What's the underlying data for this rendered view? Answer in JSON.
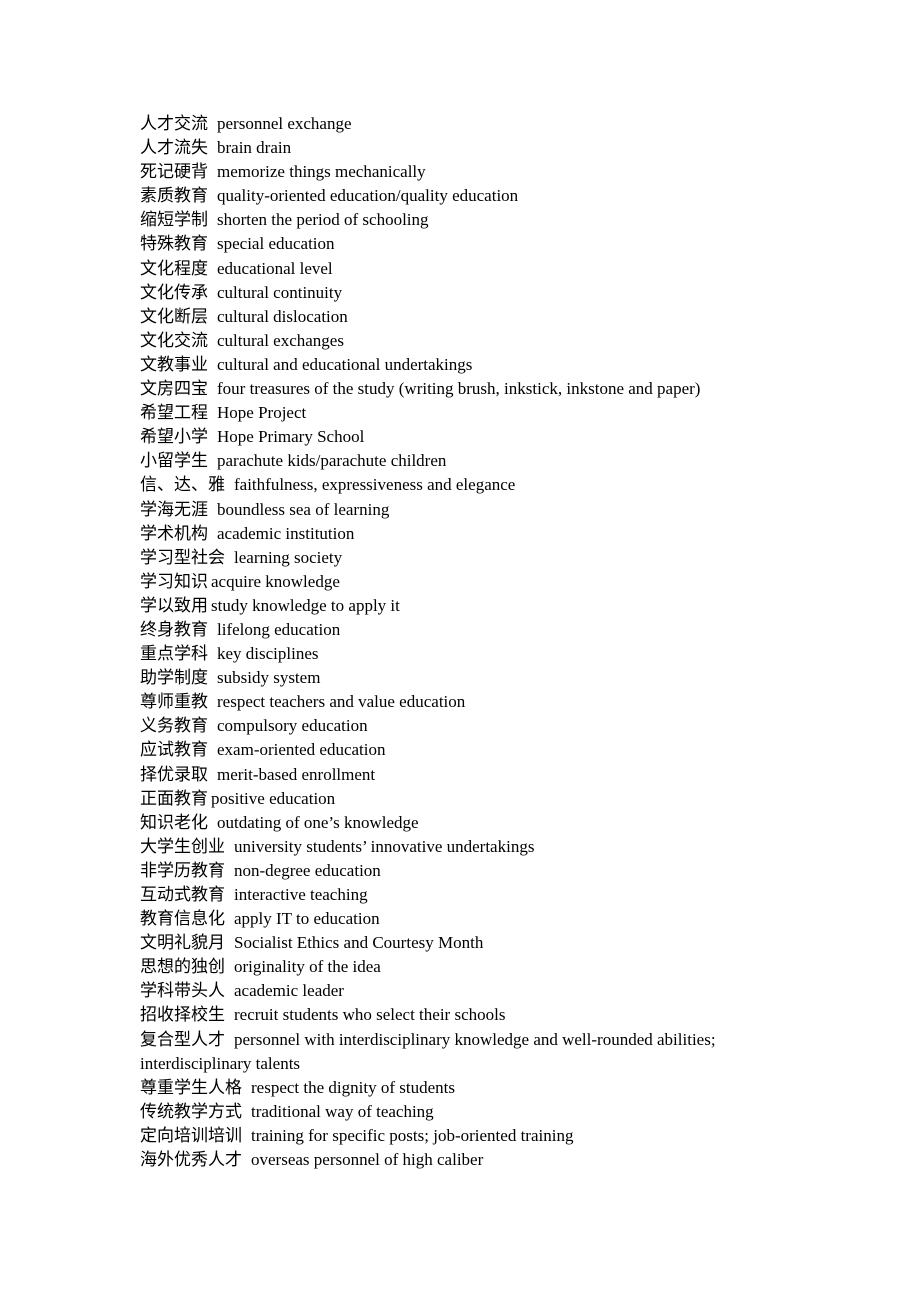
{
  "document": {
    "entries": [
      {
        "zh": "人才交流",
        "en": "personnel exchange",
        "tight": false
      },
      {
        "zh": "人才流失",
        "en": "brain drain",
        "tight": false
      },
      {
        "zh": "死记硬背",
        "en": "memorize things mechanically",
        "tight": false
      },
      {
        "zh": "素质教育",
        "en": "quality-oriented education/quality education",
        "tight": false
      },
      {
        "zh": "缩短学制",
        "en": "shorten the period of schooling",
        "tight": false
      },
      {
        "zh": "特殊教育",
        "en": "special education",
        "tight": false
      },
      {
        "zh": "文化程度",
        "en": "educational level",
        "tight": false
      },
      {
        "zh": "文化传承",
        "en": "cultural continuity",
        "tight": false
      },
      {
        "zh": "文化断层",
        "en": "cultural dislocation",
        "tight": false
      },
      {
        "zh": "文化交流",
        "en": "cultural exchanges",
        "tight": false
      },
      {
        "zh": "文教事业",
        "en": "cultural and educational undertakings",
        "tight": false
      },
      {
        "zh": "文房四宝",
        "en": "four treasures of the study (writing brush, inkstick, inkstone and paper)",
        "tight": false
      },
      {
        "zh": "希望工程",
        "en": "Hope Project",
        "tight": false
      },
      {
        "zh": "希望小学",
        "en": "Hope Primary School",
        "tight": false
      },
      {
        "zh": "小留学生",
        "en": "parachute kids/parachute children",
        "tight": false
      },
      {
        "zh": "信、达、雅",
        "en": "faithfulness, expressiveness and elegance",
        "tight": false
      },
      {
        "zh": "学海无涯",
        "en": "boundless sea of learning",
        "tight": false
      },
      {
        "zh": "学术机构",
        "en": "academic institution",
        "tight": false
      },
      {
        "zh": "学习型社会",
        "en": "learning society",
        "tight": false
      },
      {
        "zh": "学习知识",
        "en": "acquire knowledge",
        "tight": true
      },
      {
        "zh": "学以致用",
        "en": "study knowledge to apply it",
        "tight": true
      },
      {
        "zh": "终身教育",
        "en": "lifelong education",
        "tight": false
      },
      {
        "zh": "重点学科",
        "en": "key disciplines",
        "tight": false
      },
      {
        "zh": "助学制度",
        "en": "subsidy system",
        "tight": false
      },
      {
        "zh": "尊师重教",
        "en": "respect teachers and value education",
        "tight": false
      },
      {
        "zh": "义务教育",
        "en": "compulsory education",
        "tight": false
      },
      {
        "zh": "应试教育",
        "en": "exam-oriented education",
        "tight": false
      },
      {
        "zh": "择优录取",
        "en": "merit-based enrollment",
        "tight": false
      },
      {
        "zh": "正面教育",
        "en": "positive education",
        "tight": true
      },
      {
        "zh": "知识老化",
        "en": "outdating of one’s knowledge",
        "tight": false
      },
      {
        "zh": "大学生创业",
        "en": "university students’ innovative undertakings",
        "tight": false
      },
      {
        "zh": "非学历教育",
        "en": "non-degree education",
        "tight": false
      },
      {
        "zh": "互动式教育",
        "en": "interactive teaching",
        "tight": false
      },
      {
        "zh": "教育信息化",
        "en": "apply IT to education",
        "tight": false
      },
      {
        "zh": "文明礼貌月",
        "en": "Socialist Ethics and Courtesy Month",
        "tight": false
      },
      {
        "zh": "思想的独创",
        "en": "originality of the idea",
        "tight": false
      },
      {
        "zh": "学科带头人",
        "en": "academic leader",
        "tight": false
      },
      {
        "zh": "招收择校生",
        "en": "recruit students who select their schools",
        "tight": false
      },
      {
        "zh": "复合型人才",
        "en": "personnel with interdisciplinary knowledge and well-rounded abilities; interdisciplinary talents",
        "tight": false
      },
      {
        "zh": "尊重学生人格",
        "en": "respect the dignity of students",
        "tight": false
      },
      {
        "zh": "传统教学方式",
        "en": "traditional way of teaching",
        "tight": false
      },
      {
        "zh": "定向培训培训",
        "en": "training for specific posts; job-oriented training",
        "tight": false
      },
      {
        "zh": "海外优秀人才",
        "en": "overseas personnel of high caliber",
        "tight": false
      }
    ]
  }
}
